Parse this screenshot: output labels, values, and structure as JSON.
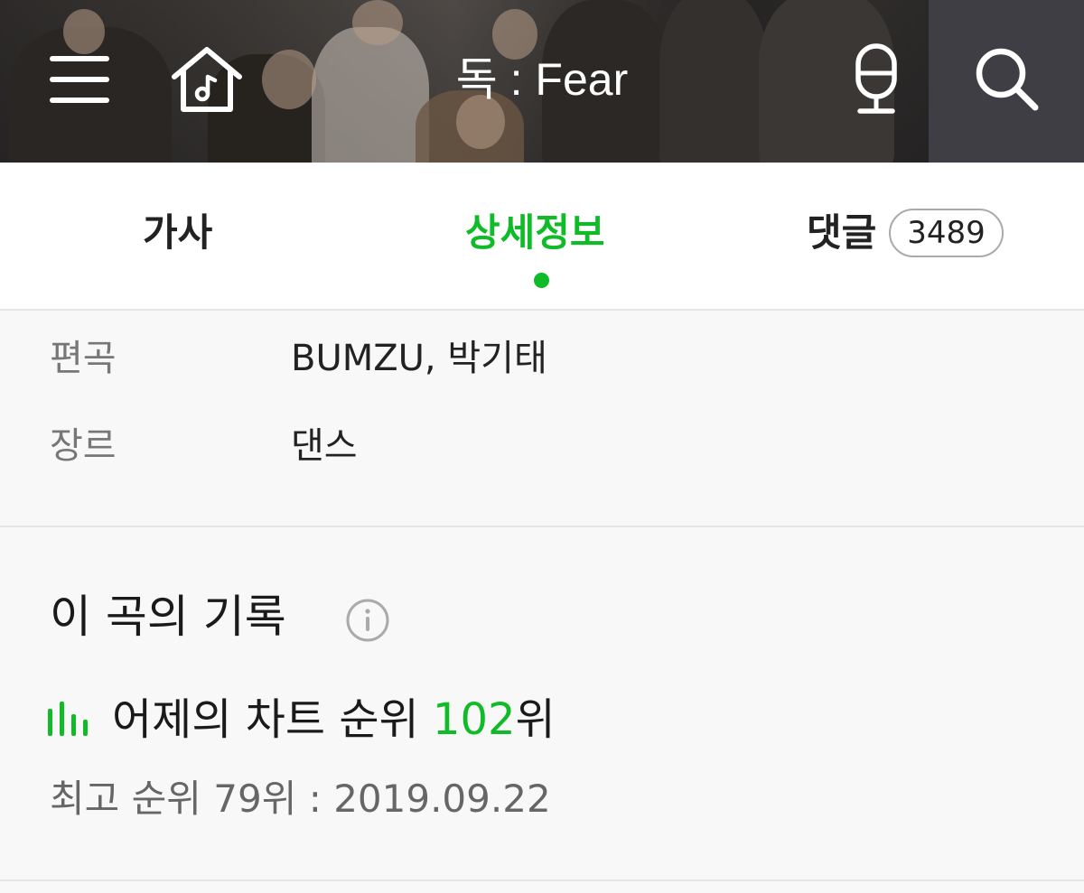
{
  "header": {
    "title": "독 : Fear",
    "icons": [
      "menu-icon",
      "home-music-icon",
      "microphone-icon",
      "search-icon"
    ]
  },
  "tabs": {
    "lyrics": "가사",
    "details": "상세정보",
    "comments": "댓글",
    "comment_count": "3489",
    "active": "details"
  },
  "info_rows": [
    {
      "label": "편곡",
      "value": "BUMZU, 박기태"
    },
    {
      "label": "장르",
      "value": "댄스"
    }
  ],
  "record": {
    "title": "이 곡의 기록",
    "chart_prefix": "어제의 차트 순위 ",
    "chart_rank": "102",
    "chart_suffix": "위",
    "best_rank": "최고 순위 79위 : 2019.09.22"
  },
  "colors": {
    "accent": "#0fbb27",
    "text": "#1a1a1a",
    "muted": "#777777",
    "background": "#f8f8f8"
  }
}
